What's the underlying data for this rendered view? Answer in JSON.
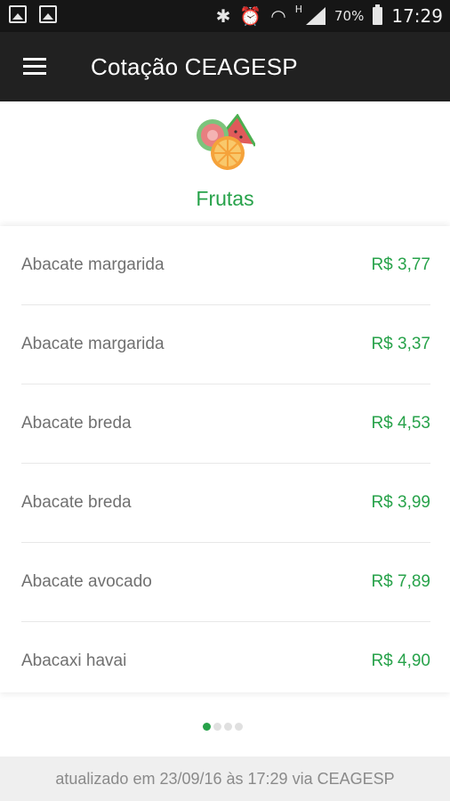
{
  "status_bar": {
    "battery": "70%",
    "time": "17:29",
    "network_mark": "H",
    "icons": [
      "image-icon",
      "image-sync-icon",
      "bluetooth-icon",
      "alarm-icon",
      "wifi-icon",
      "signal-icon",
      "battery-icon"
    ]
  },
  "app_bar": {
    "title": "Cotação CEAGESP",
    "menu_icon": "hamburger-menu-icon"
  },
  "category": {
    "title": "Frutas",
    "icon": "fruit-icon"
  },
  "items": [
    {
      "name": "Abacate margarida",
      "price": "R$ 3,77"
    },
    {
      "name": "Abacate margarida",
      "price": "R$ 3,37"
    },
    {
      "name": "Abacate breda",
      "price": "R$ 4,53"
    },
    {
      "name": "Abacate breda",
      "price": "R$ 3,99"
    },
    {
      "name": "Abacate avocado",
      "price": "R$ 7,89"
    },
    {
      "name": "Abacaxi havai",
      "price": "R$ 4,90"
    }
  ],
  "pager": {
    "count": 4,
    "active": 1
  },
  "footer": {
    "text": "atualizado em 23/09/16 às 17:29 via CEAGESP"
  },
  "colors": {
    "accent": "#27a24a",
    "app_bar": "#212121",
    "status_bar": "#161616"
  }
}
